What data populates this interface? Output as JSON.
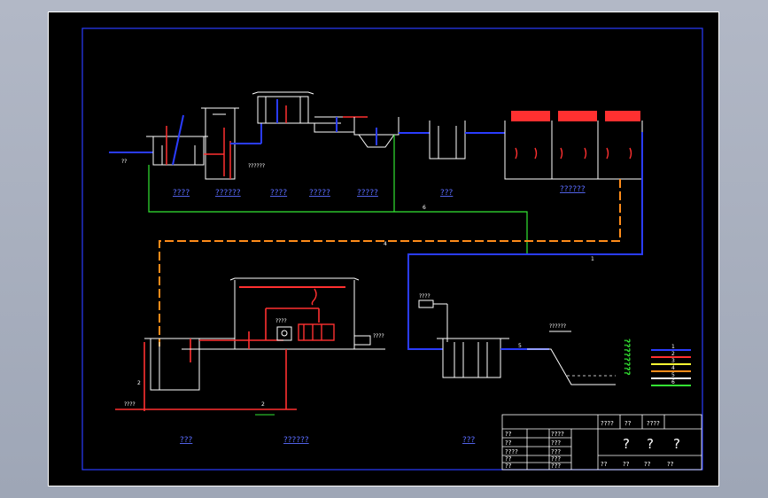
{
  "process_labels": {
    "row1": [
      "????",
      "??????",
      "????",
      "?????",
      "?????",
      "???",
      "??????"
    ],
    "row2": [
      "???",
      "??????",
      "???"
    ]
  },
  "annotations": {
    "inlet_label": "??",
    "sludge_note": "??????",
    "dose_note": "????",
    "outfall_note": "??????",
    "box_label": "????",
    "sludge_out": "????",
    "cake_out": "????",
    "outlet_label": "???",
    "line_num_1": "1",
    "line_num_2": "2",
    "line_num_3": "3",
    "line_num_4": "4",
    "line_num_5": "5",
    "line_num_6": "6",
    "pump_label": "2"
  },
  "legend": {
    "title_chars": "????????",
    "items": [
      "1",
      "2",
      "3",
      "4",
      "5",
      "6"
    ],
    "colors": [
      "#2a3cff",
      "#ff3030",
      "#ffff33",
      "#ff8c1a",
      "#ffffff",
      "#33e633"
    ]
  },
  "title_block": {
    "cells_left": [
      "??",
      "??",
      "????",
      "??",
      "??"
    ],
    "cells_mid": [
      "????",
      "???",
      "???",
      "???",
      "???"
    ],
    "header": [
      "????",
      "??",
      "????"
    ],
    "big": [
      "?",
      "?",
      "?"
    ],
    "bottom": [
      "??",
      "??",
      "??",
      "??"
    ]
  },
  "colors": {
    "sheet_bg": "#000000",
    "frame_blue": "#2a3cff",
    "water_blue": "#2a3cff",
    "sludge_red": "#ff3030",
    "air_orange": "#ff8c1a",
    "return_green": "#33e633",
    "label_blue": "#5a6cff"
  }
}
